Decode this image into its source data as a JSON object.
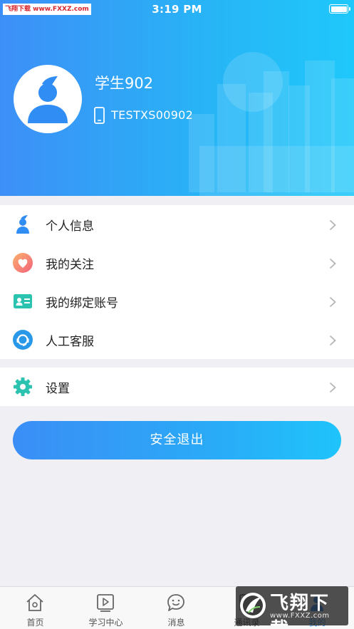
{
  "status_bar": {
    "watermark": "飞翔下载 www.FXXZ.com",
    "time": "3:19 PM"
  },
  "profile": {
    "name": "学生902",
    "account": "TESTXS00902"
  },
  "menu": [
    {
      "label": "个人信息",
      "icon": "person-icon",
      "color": "#2f8df4"
    },
    {
      "label": "我的关注",
      "icon": "heart-icon",
      "color": "#f7746a"
    },
    {
      "label": "我的绑定账号",
      "icon": "id-card-icon",
      "color": "#2bc3b0"
    },
    {
      "label": "人工客服",
      "icon": "headset-icon",
      "color": "#2a98e8"
    }
  ],
  "settings": {
    "label": "设置",
    "icon": "gear-icon",
    "color": "#2bc3b0"
  },
  "logout_label": "安全退出",
  "tabs": [
    {
      "label": "首页",
      "icon": "home-icon"
    },
    {
      "label": "学习中心",
      "icon": "play-icon"
    },
    {
      "label": "消息",
      "icon": "chat-icon"
    },
    {
      "label": "通讯录",
      "icon": "contacts-icon"
    },
    {
      "label": "我的",
      "icon": "me-icon",
      "active": true
    }
  ],
  "watermark_badge": {
    "title": "飞翔下载",
    "url": "www.FXXZ.com"
  },
  "colors": {
    "header_start": "#3d8ff7",
    "header_end": "#1fc8fb",
    "active_tab": "#2f8df4"
  }
}
